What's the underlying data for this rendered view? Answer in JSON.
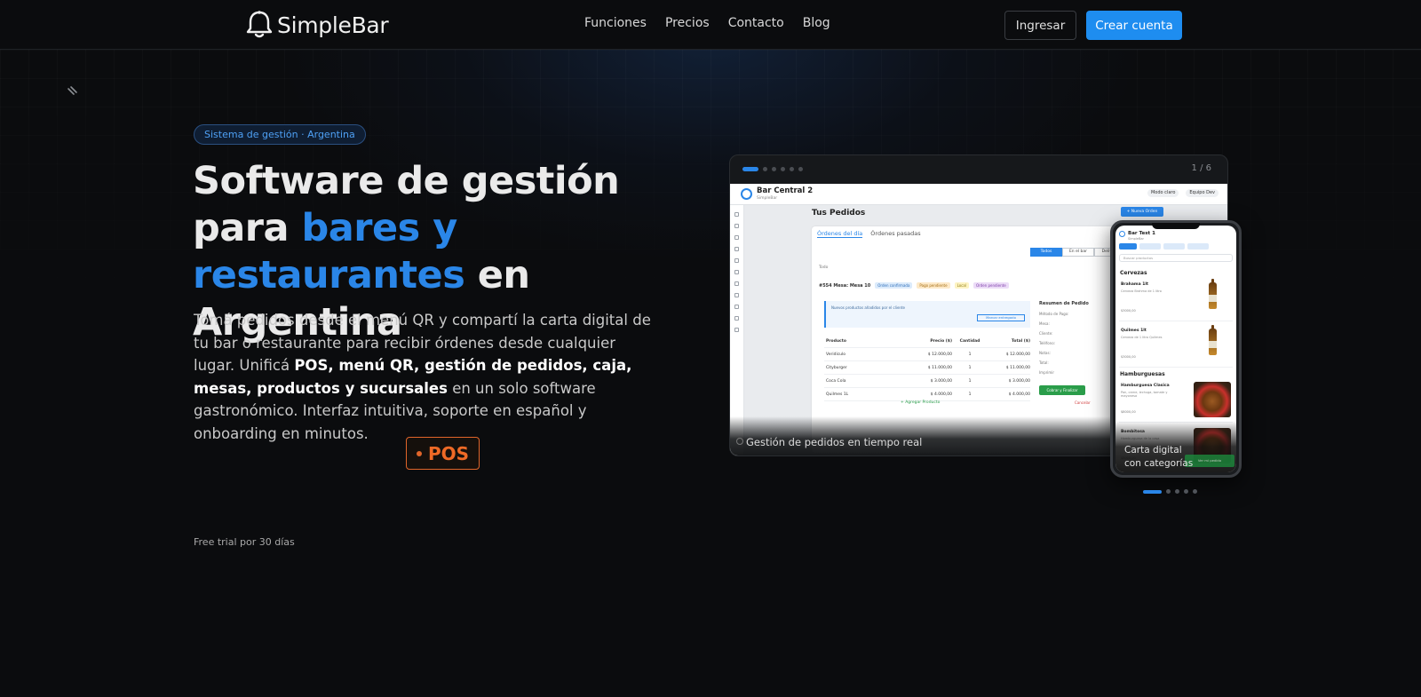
{
  "brand": {
    "name": "SimpleBar",
    "accent": "#2a86e8",
    "cta_color": "#1e8df0",
    "pos_color": "#e0652a"
  },
  "nav": {
    "items": [
      {
        "label": "Funciones"
      },
      {
        "label": "Precios"
      },
      {
        "label": "Contacto"
      },
      {
        "label": "Blog"
      }
    ],
    "login_label": "Ingresar",
    "signup_label": "Crear cuenta"
  },
  "hero": {
    "badge": "Sistema de gestión · Argentina",
    "title_part1": "Software de gestión para ",
    "title_accent": "bares y restaurantes",
    "title_part2": " en Argentina",
    "desc_1": "Tomá pedidos desde el menú QR y compartí la carta digital de tu bar o restaurante para recibir órdenes desde cualquier lugar. Unificá ",
    "desc_bold": "POS, menú QR, gestión de pedidos, caja, mesas, productos y sucursales",
    "desc_2": " en un solo software gastronómico. Interfaz intuitiva, soporte en español y onboarding en minutos.",
    "rotating_word": "POS",
    "trial": "Free trial por 30 días"
  },
  "desktop_mockup": {
    "counter": "1 / 6",
    "caption": "Gestión de pedidos en tiempo real",
    "app": {
      "title": "Bar Central 2",
      "subtitle": "SimpleBar",
      "mode": "Modo claro",
      "user": "Equipo Dev",
      "page_title": "Tus Pedidos",
      "new_order": "+ Nueva Orden",
      "tab_day": "Órdenes del día",
      "tab_past": "Órdenes pasadas",
      "seg_all": "Todos",
      "seg_bar": "En el bar",
      "seg_delivery": "Delivery",
      "filter": "Todo",
      "order_id": "#554 Mesa: Mesa 10",
      "tags": [
        "Orden confirmada",
        "Pago pendiente",
        "Local",
        "Orden pendiente"
      ],
      "note": "Nuevos productos añadidos por el cliente",
      "note_btn": "Marcar entregado",
      "columns": [
        "Producto",
        "Precio ($)",
        "Cantidad",
        "Total ($)"
      ],
      "rows": [
        [
          "Veridiculo",
          "$ 12.000,00",
          "1",
          "$ 12.000,00"
        ],
        [
          "Cityburger",
          "$ 11.000,00",
          "1",
          "$ 11.000,00"
        ],
        [
          "Coca Cola",
          "$ 3.000,00",
          "1",
          "$ 3.000,00"
        ],
        [
          "Quilmes 1L",
          "$ 4.000,00",
          "1",
          "$ 4.000,00"
        ]
      ],
      "add_product": "+ Agregar Producto",
      "summary_title": "Resumen de Pedido",
      "summary_lines": [
        "Método de Pago:",
        "Mesa:",
        "Cliente:",
        "Teléfono:",
        "Notas:",
        "Total:"
      ],
      "print": "Imprimir",
      "cobrar": "Cobrar y Finalizar",
      "cancel": "Cancelar"
    }
  },
  "phone_mockup": {
    "caption": "Carta digital con categorías",
    "app": {
      "title": "Bar Test 1",
      "subtitle": "SimpleBar",
      "search": "Buscar productos",
      "section_1": "Cervezas",
      "section_2": "Hamburguesas",
      "items": [
        {
          "name": "Brahama 1lt",
          "desc": "Cerveza Brahma de 1 litro",
          "price": "$3000,00"
        },
        {
          "name": "Quilmes 1lt",
          "desc": "Cerveza de 1 litro Quilmes",
          "price": "$3000,00"
        },
        {
          "name": "Hamburguesa Clasica",
          "desc": "Pan, carne, lechuga, tomate y mayonesa",
          "price": "$8000,00"
        },
        {
          "name": "Bombitosa",
          "desc": "Hamburguesa de la casa",
          "price": "$8000,00"
        }
      ],
      "btn": "Ver mi pedido"
    }
  }
}
